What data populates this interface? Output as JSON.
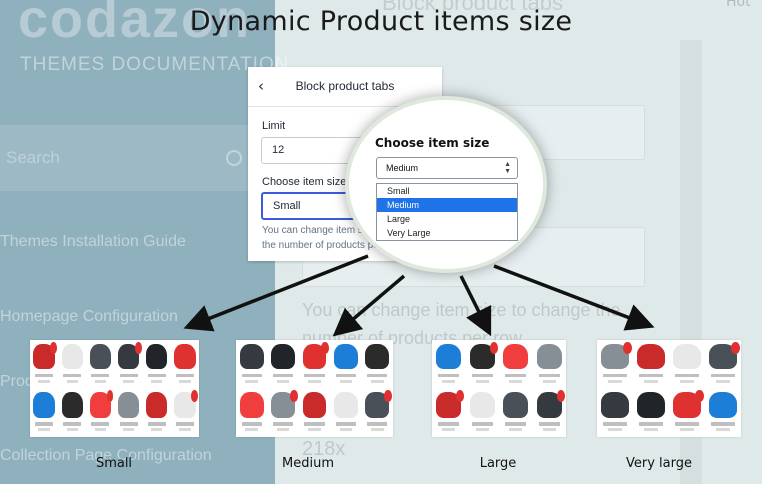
{
  "background": {
    "logo": "codazon",
    "docs_title": "THEMES DOCUMENTATION",
    "search_placeholder": "Search",
    "nav": [
      "Themes Installation Guide",
      "Homepage Configuration",
      "Product",
      "Collection Page Configuration"
    ],
    "panel_title": "Block product tabs",
    "help_text_large": "You can change item size to change the number of products per row",
    "size_value": "218x",
    "hook": "Hot"
  },
  "headline": "Dynamic Product items size",
  "panel": {
    "title": "Block product tabs",
    "limit_label": "Limit",
    "limit_value": "12",
    "item_size_label": "Choose item size",
    "item_size_value": "Small",
    "help_text": "You can change item size to change the number of products per row"
  },
  "magnifier": {
    "label": "Choose item size",
    "selected": "Medium",
    "options": [
      "Small",
      "Medium",
      "Large",
      "Very Large"
    ]
  },
  "thumbnails": [
    {
      "label": "Small",
      "columns": 6,
      "rows": 2
    },
    {
      "label": "Medium",
      "columns": 5,
      "rows": 2
    },
    {
      "label": "Large",
      "columns": 4,
      "rows": 2
    },
    {
      "label": "Very large",
      "columns": 4,
      "rows": 2
    }
  ],
  "colors": {
    "accent_select": "#3b5bdb",
    "dropdown_highlight": "#1e73e8",
    "sale_badge": "#e03131",
    "arrow": "#111111"
  }
}
